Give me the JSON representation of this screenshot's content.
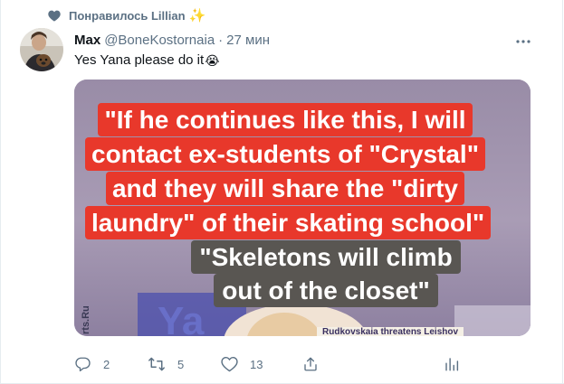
{
  "social_context": {
    "text": "Понравилось Lillian",
    "emoji": "✨",
    "icon": "heart-icon"
  },
  "tweet": {
    "author_name": "Max",
    "handle": "@BoneKostornaia",
    "separator": "·",
    "time": "27 мин",
    "text": "Yes Yana please do it",
    "text_emoji": "😭",
    "more_icon": "more-icon"
  },
  "media": {
    "caption_red_lines": [
      "\"If he continues like this, I will",
      "contact ex-students of \"Crystal\"",
      "and they will share the \"dirty",
      "laundry\" of their skating school\""
    ],
    "caption_grey_lines": [
      "\"Skeletons will climb",
      "out of the closet\""
    ],
    "watermark": "rts.Ru",
    "lower_text": "Rudkovskaia threatens Leishov"
  },
  "actions": {
    "reply_count": "2",
    "retweet_count": "5",
    "like_count": "13",
    "icons": [
      "reply-icon",
      "retweet-icon",
      "like-icon",
      "share-icon",
      "analytics-icon"
    ]
  },
  "colors": {
    "secondary_text": "#5b7083",
    "caption_red": "#e8382b",
    "caption_grey": "#595652",
    "media_bg": "#a497b1"
  }
}
